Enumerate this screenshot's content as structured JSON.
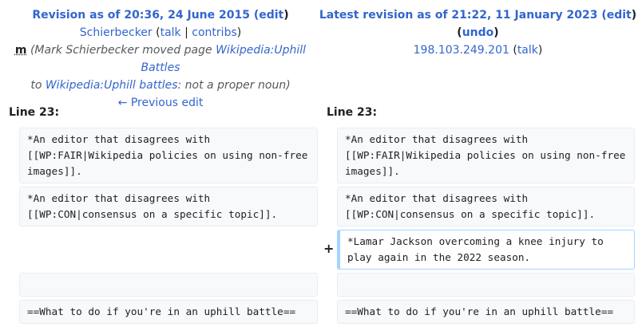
{
  "left_header": {
    "title_prefix": "Revision as of 20:36, 24 June 2015 (",
    "edit_link": "edit",
    "title_suffix": ")",
    "user": "Schierbecker",
    "talk": "talk",
    "contribs": "contribs",
    "minor_mark": "m",
    "summary_prefix": "(Mark Schierbecker moved page ",
    "summary_link1": "Wikipedia:Uphill Battles",
    "summary_middle": " to ",
    "summary_link2": "Wikipedia:Uphill battles",
    "summary_suffix": ": not a proper noun)",
    "prev_edit": "← Previous edit"
  },
  "right_header": {
    "title_prefix": "Latest revision as of 21:22, 11 January 2023 (",
    "edit_link": "edit",
    "title_mid": ") (",
    "undo_link": "undo",
    "title_suffix": ")",
    "user": "198.103.249.201",
    "talk": "talk"
  },
  "diff": {
    "left_line": "Line 23:",
    "right_line": "Line 23:",
    "added_marker": "+",
    "rows": [
      {
        "left": "*An editor that disagrees with [[WP:FAIR|Wikipedia policies on using non-free images]].",
        "right": "*An editor that disagrees with [[WP:FAIR|Wikipedia policies on using non-free images]]."
      },
      {
        "left": "*An editor that disagrees with [[WP:CON|consensus on a specific topic]].",
        "right": "*An editor that disagrees with [[WP:CON|consensus on a specific topic]]."
      },
      {
        "left": "",
        "right": "*Lamar Jackson overcoming a knee injury to play again in the 2022 season."
      },
      {
        "left": "",
        "right": ""
      },
      {
        "left": "==What to do if you're in an uphill battle==",
        "right": "==What to do if you're in an uphill battle=="
      }
    ]
  }
}
